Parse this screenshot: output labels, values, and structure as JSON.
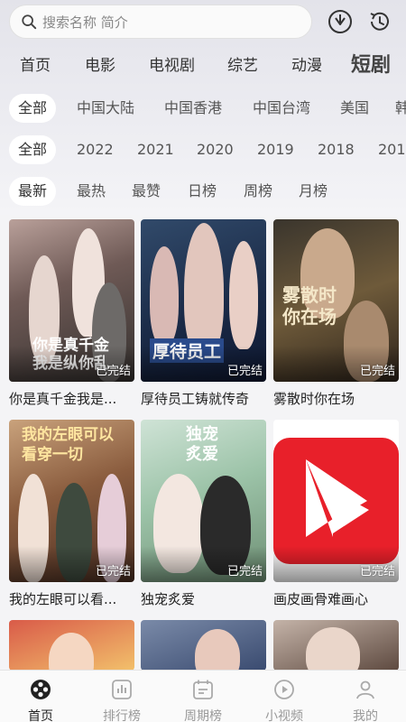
{
  "search": {
    "placeholder": "搜索名称 简介"
  },
  "top_nav": [
    "首页",
    "电影",
    "电视剧",
    "综艺",
    "动漫",
    "短剧"
  ],
  "region_filter": [
    "全部",
    "中国大陆",
    "中国香港",
    "中国台湾",
    "美国",
    "韩"
  ],
  "year_filter": [
    "全部",
    "2022",
    "2021",
    "2020",
    "2019",
    "2018",
    "201"
  ],
  "sort_filter": [
    "最新",
    "最热",
    "最赞",
    "日榜",
    "周榜",
    "月榜"
  ],
  "items": [
    {
      "title": "你是真千金我是...",
      "status": "已完结",
      "poster_text": "你是真千金\n我是纵你乱"
    },
    {
      "title": "厚待员工铸就传奇",
      "status": "已完结",
      "poster_text": "厚待员工"
    },
    {
      "title": "雾散时你在场",
      "status": "已完结",
      "poster_text": "雾散时\n你在场"
    },
    {
      "title": "我的左眼可以看...",
      "status": "已完结",
      "poster_text": "我的左眼可以\n看穿一切"
    },
    {
      "title": "独宠炙爱",
      "status": "已完结",
      "poster_text": "独宠\n炙爱"
    },
    {
      "title": "画皮画骨难画心",
      "status": "已完结",
      "poster_text": ""
    },
    {
      "title": "",
      "status": "",
      "poster_text": ""
    },
    {
      "title": "",
      "status": "",
      "poster_text": ""
    },
    {
      "title": "",
      "status": "",
      "poster_text": ""
    }
  ],
  "bottom_nav": [
    "首页",
    "排行榜",
    "周期榜",
    "小视频",
    "我的"
  ],
  "colors": {
    "accent": "#e8202a",
    "active_text": "#222222",
    "inactive_text": "#999999"
  }
}
